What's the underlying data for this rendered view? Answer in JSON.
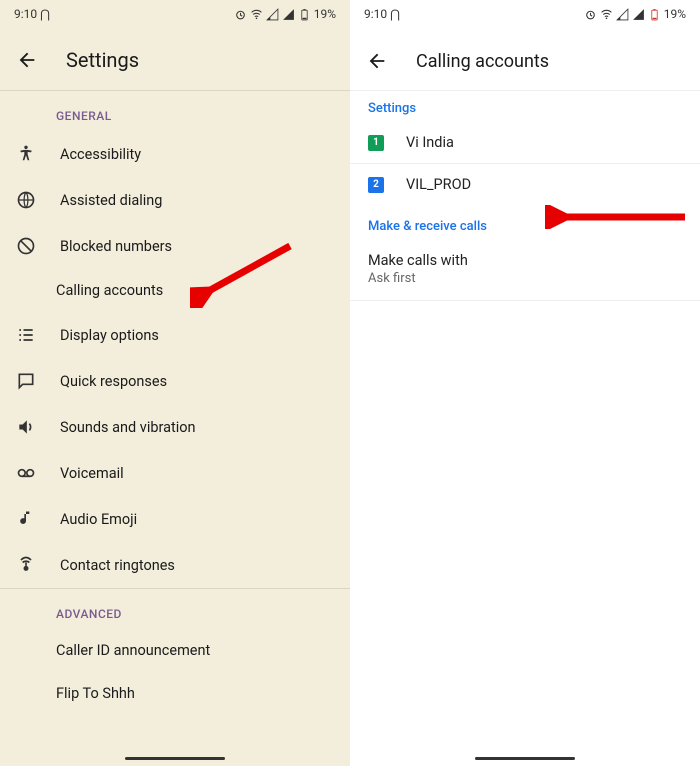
{
  "statusbar": {
    "time": "9:10",
    "battery_pct": "19%"
  },
  "left": {
    "title": "Settings",
    "sections": {
      "general": "GENERAL",
      "advanced": "ADVANCED"
    },
    "items": {
      "accessibility": "Accessibility",
      "assisted_dialing": "Assisted dialing",
      "blocked_numbers": "Blocked numbers",
      "calling_accounts": "Calling accounts",
      "display_options": "Display options",
      "quick_responses": "Quick responses",
      "sounds_vibration": "Sounds and vibration",
      "voicemail": "Voicemail",
      "audio_emoji": "Audio Emoji",
      "contact_ringtones": "Contact ringtones",
      "caller_id": "Caller ID announcement",
      "flip_shhh": "Flip To Shhh"
    }
  },
  "right": {
    "title": "Calling accounts",
    "sections": {
      "settings": "Settings",
      "make_receive": "Make & receive calls"
    },
    "sims": {
      "sim1_num": "1",
      "sim1_label": "Vi India",
      "sim2_num": "2",
      "sim2_label": "VIL_PROD"
    },
    "make_calls": {
      "title": "Make calls with",
      "value": "Ask first"
    }
  }
}
